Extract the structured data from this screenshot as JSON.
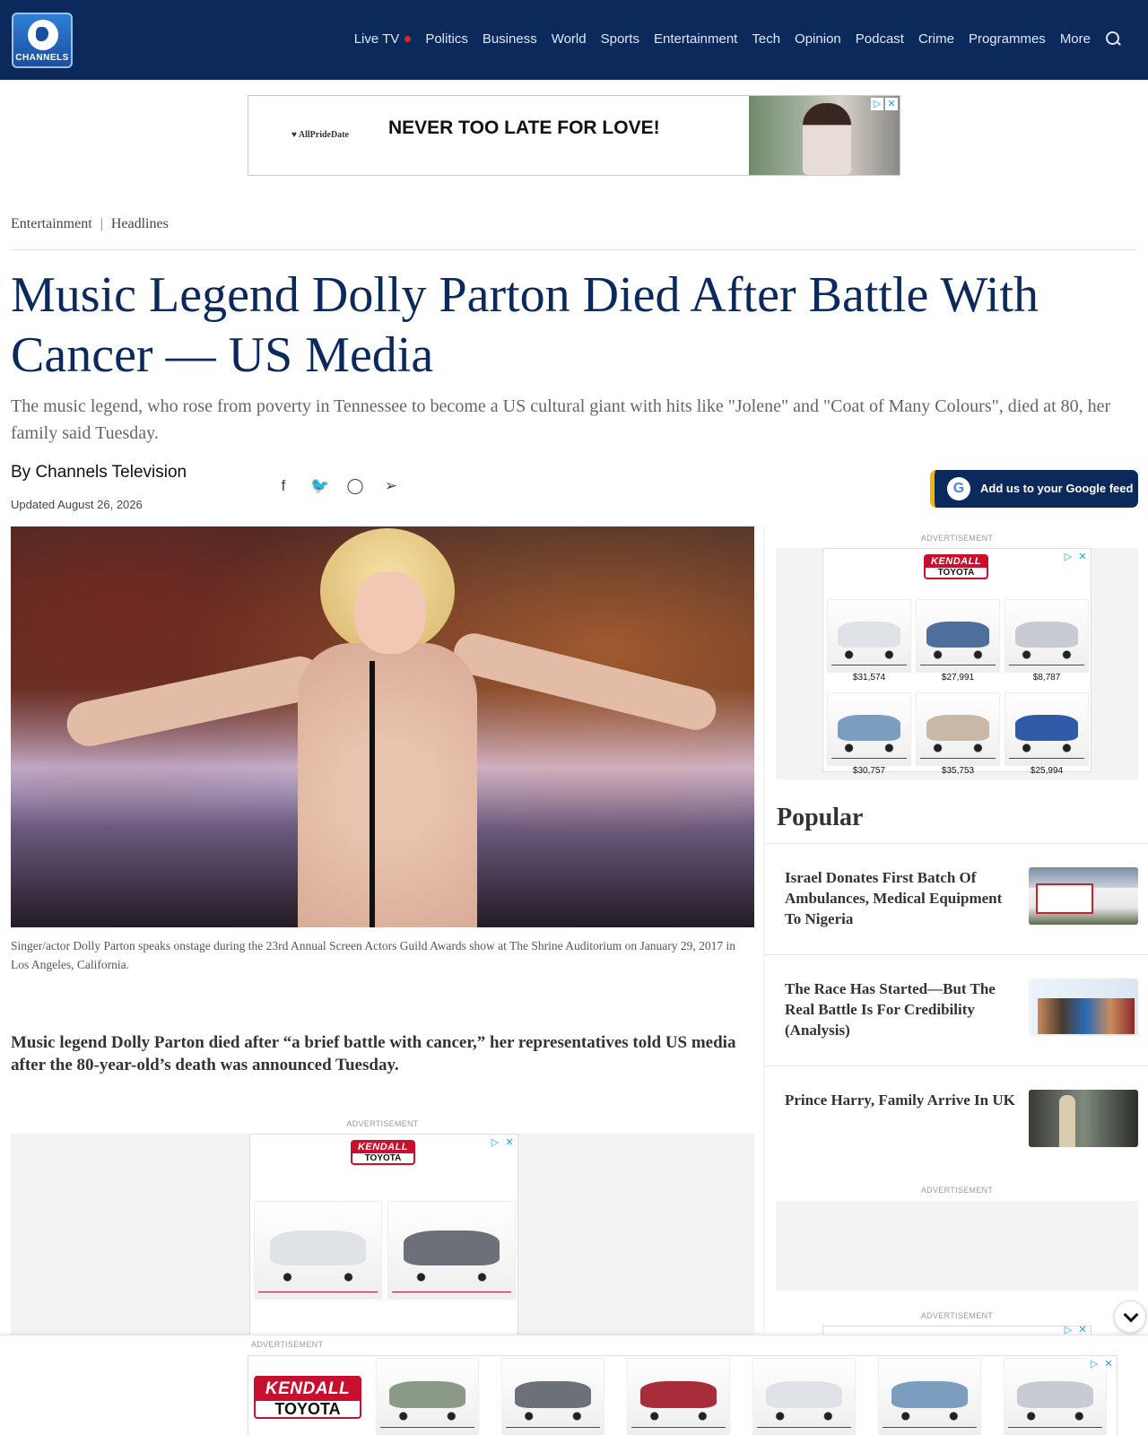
{
  "brand": {
    "logo_text": "CHANNELS"
  },
  "nav": {
    "live_tv": "Live TV",
    "items": [
      "Politics",
      "Business",
      "World",
      "Sports",
      "Entertainment",
      "Tech",
      "Opinion",
      "Podcast",
      "Crime",
      "Programmes",
      "More"
    ],
    "search_icon": "search-icon"
  },
  "top_banner": {
    "advertiser": "AllPrideDate",
    "slogan": "NEVER TOO LATE FOR LOVE!"
  },
  "breadcrumb": {
    "section": "Entertainment",
    "separator": "|",
    "subsection": "Headlines"
  },
  "article": {
    "headline": "Music Legend Dolly Parton Died After Battle With Cancer — US Media",
    "standfirst": "The music legend, who rose from poverty in Tennessee to become a US cultural giant with hits like \"Jolene\" and \"Coat of Many Colours\", died at 80, her family said Tuesday.",
    "byline": "By Channels Television",
    "updated": "Updated August 26, 2026",
    "image_caption": "Singer/actor Dolly Parton speaks onstage during the 23rd Annual Screen Actors Guild Awards show at The Shrine Auditorium on January 29, 2017 in Los Angeles, California.",
    "lead": "Music legend Dolly Parton died after “a brief battle with cancer,” her representatives told US media after the 80-year-old’s death was announced Tuesday."
  },
  "share_icons": [
    "facebook-icon",
    "twitter-icon",
    "whatsapp-icon",
    "telegram-icon"
  ],
  "google_feed": {
    "label": "Add us to your Google feed",
    "icon": "G"
  },
  "ads": {
    "label": "ADVERTISEMENT",
    "kendall_top": "KENDALL",
    "kendall_bottom": "TOYOTA",
    "dealer_strip": "KENDALL TOYOTA",
    "side_prices": [
      "$31,574",
      "$27,991",
      "$8,787",
      "$30,757",
      "$35,753",
      "$25,994"
    ]
  },
  "popular": {
    "title": "Popular",
    "items": [
      {
        "title": "Israel Donates First Batch Of Ambulances, Medical Equipment To Nigeria"
      },
      {
        "title": "The Race Has Started—But The Real Battle Is For Credibility (Analysis)"
      },
      {
        "title": "Prince Harry, Family Arrive In UK"
      }
    ]
  },
  "colors": {
    "navy": "#0b2a5b",
    "accent_red": "#e0242a",
    "kendall_red": "#c8102e"
  }
}
